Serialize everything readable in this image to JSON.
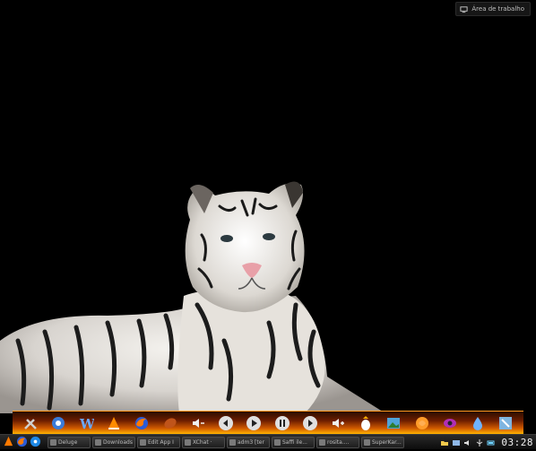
{
  "desktop": {
    "label": "Área de trabalho",
    "label_icon": "desktop-icon"
  },
  "dock": {
    "icons": [
      "system-tools-icon",
      "kde-icon",
      "wikipedia-icon",
      "vlc-icon",
      "firefox-icon",
      "media-rewind-icon",
      "volume-down-icon",
      "previous-track-icon",
      "play-icon",
      "pause-icon",
      "next-track-icon",
      "volume-up-icon",
      "installer-icon",
      "image-viewer-icon",
      "browser-icon",
      "eye-icon",
      "water-drop-icon",
      "tools-icon"
    ]
  },
  "taskbar": {
    "launchers": [
      "start-menu-icon",
      "firefox-icon",
      "browser-icon"
    ],
    "tasks": [
      "Deluge",
      "Downloads",
      "Edit App I",
      "XChat ·",
      "adm3 [ter",
      "Saffi ile...",
      "rosita....",
      "SuperKar..."
    ],
    "tray": [
      "folder-icon",
      "network-icon",
      "volume-icon",
      "usb-icon",
      "battery-icon"
    ],
    "clock": "03:28"
  }
}
